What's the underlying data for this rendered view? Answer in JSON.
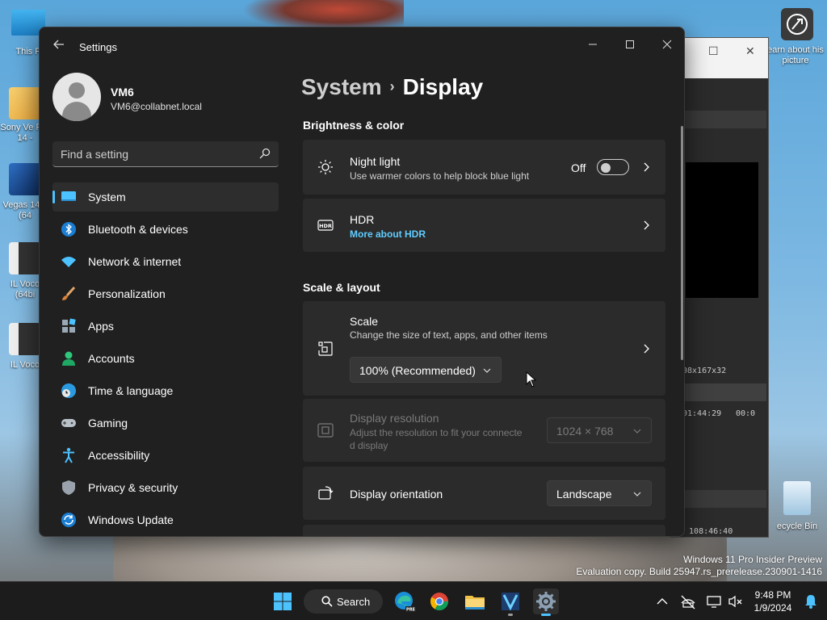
{
  "desktop": {
    "icons": [
      {
        "label": "This P"
      },
      {
        "label": "Sony Ve Pro 14 -"
      },
      {
        "label": "Vegas 14.0 (64"
      },
      {
        "label": "IL Voco (64bi"
      },
      {
        "label": "IL Voco"
      }
    ],
    "spotlight_label": "earn about his picture",
    "recycle_bin_label": "ecycle Bin"
  },
  "background_window": {
    "resolution_text": "08x167x32",
    "timecode_1": "01:44:29",
    "timecode_2": "00:0",
    "timecode_3": ": 108:46:40"
  },
  "settings": {
    "window_title": "Settings",
    "profile": {
      "name": "VM6",
      "email": "VM6@collabnet.local"
    },
    "search": {
      "placeholder": "Find a setting"
    },
    "nav": [
      {
        "label": "System",
        "icon": "system-icon",
        "selected": true
      },
      {
        "label": "Bluetooth & devices",
        "icon": "bluetooth-icon"
      },
      {
        "label": "Network & internet",
        "icon": "wifi-icon"
      },
      {
        "label": "Personalization",
        "icon": "brush-icon"
      },
      {
        "label": "Apps",
        "icon": "apps-icon"
      },
      {
        "label": "Accounts",
        "icon": "person-icon"
      },
      {
        "label": "Time & language",
        "icon": "globe-clock-icon"
      },
      {
        "label": "Gaming",
        "icon": "gamepad-icon"
      },
      {
        "label": "Accessibility",
        "icon": "accessibility-icon"
      },
      {
        "label": "Privacy & security",
        "icon": "shield-icon"
      },
      {
        "label": "Windows Update",
        "icon": "update-icon"
      }
    ],
    "breadcrumb": {
      "parent": "System",
      "separator": "›",
      "current": "Display"
    },
    "sections": {
      "brightness": {
        "title": "Brightness & color",
        "night_light": {
          "title": "Night light",
          "subtitle": "Use warmer colors to help block blue light",
          "state": "Off"
        },
        "hdr": {
          "title": "HDR",
          "link": "More about HDR"
        }
      },
      "scale_layout": {
        "title": "Scale & layout",
        "scale": {
          "title": "Scale",
          "subtitle": "Change the size of text, apps, and other items",
          "value": "100% (Recommended)"
        },
        "resolution": {
          "title": "Display resolution",
          "subtitle_line1": "Adjust the resolution to fit your connecte",
          "subtitle_line2": "d display",
          "value": "1024 × 768"
        },
        "orientation": {
          "title": "Display orientation",
          "value": "Landscape"
        }
      }
    }
  },
  "watermark": {
    "line1": "Windows 11 Pro Insider Preview",
    "line2": "Evaluation copy. Build 25947.rs_prerelease.230901-1416"
  },
  "taskbar": {
    "search_label": "Search",
    "time": "9:48 PM",
    "date": "1/9/2024",
    "accent": "#4cc2ff"
  }
}
